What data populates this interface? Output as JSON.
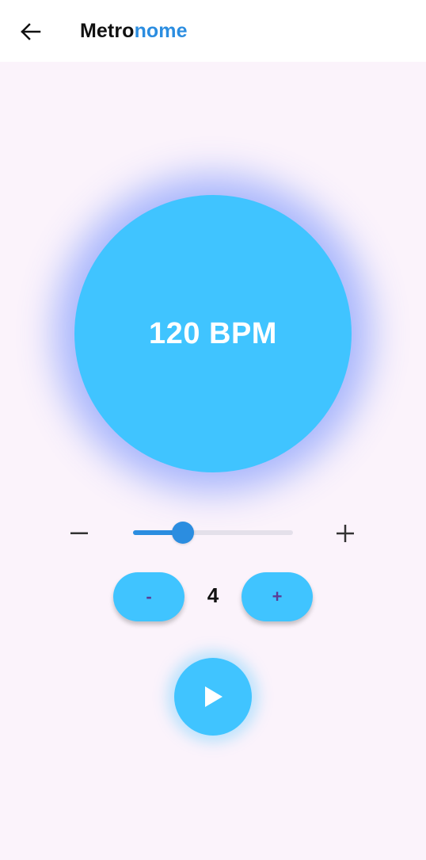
{
  "app_bar": {
    "title_part1": "Metro",
    "title_part2": "nome",
    "back_icon": "arrow-left-icon"
  },
  "colors": {
    "accent": "#40c4ff",
    "primary": "#2b8de0",
    "background": "#fbf3fb",
    "button_text": "#5a3d96"
  },
  "metronome": {
    "bpm_label": "120 BPM",
    "tempo_slider": {
      "position_fraction": 0.31,
      "decrease_icon": "minus-icon",
      "increase_icon": "plus-icon"
    },
    "beats": {
      "decrement_label": "-",
      "count": "4",
      "increment_label": "+"
    },
    "play_icon": "play-icon"
  }
}
